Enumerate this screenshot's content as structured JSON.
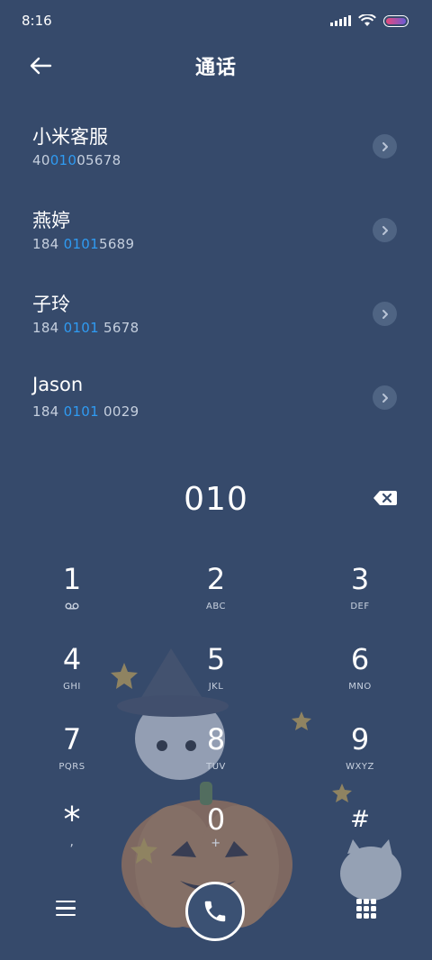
{
  "status_bar": {
    "time": "8:16",
    "icons": [
      "signal-icon",
      "wifi-icon",
      "battery-icon"
    ]
  },
  "header": {
    "title": "通话",
    "back_icon": "arrow-left-icon"
  },
  "results": [
    {
      "name": "小米客服",
      "number_pre": "40",
      "number_match": "010",
      "number_post": "05678"
    },
    {
      "name": "燕婷",
      "number_pre": "184 ",
      "number_match": "0101",
      "number_post": "5689"
    },
    {
      "name": "子玲",
      "number_pre": "184 ",
      "number_match": "0101",
      "number_post": " 5678"
    },
    {
      "name": "Jason",
      "number_pre": "184 ",
      "number_match": "0101",
      "number_post": " 0029"
    }
  ],
  "dialer": {
    "digits": "010",
    "backspace_icon": "backspace-icon"
  },
  "keypad": [
    {
      "digit": "1",
      "letters": "",
      "icon": "voicemail-icon"
    },
    {
      "digit": "2",
      "letters": "ABC"
    },
    {
      "digit": "3",
      "letters": "DEF"
    },
    {
      "digit": "4",
      "letters": "GHI"
    },
    {
      "digit": "5",
      "letters": "JKL"
    },
    {
      "digit": "6",
      "letters": "MNO"
    },
    {
      "digit": "7",
      "letters": "PQRS"
    },
    {
      "digit": "8",
      "letters": "TUV"
    },
    {
      "digit": "9",
      "letters": "WXYZ"
    },
    {
      "digit": "*",
      "letters": ","
    },
    {
      "digit": "0",
      "letters": "+"
    },
    {
      "digit": "#",
      "letters": ""
    }
  ],
  "bottom_bar": {
    "menu_icon": "menu-icon",
    "call_icon": "phone-icon",
    "keypad_icon": "keypad-grid-icon"
  },
  "colors": {
    "background": "#364a6b",
    "match_highlight": "#2f9bf2",
    "text_primary": "#ffffff",
    "text_secondary": "#c5cfde"
  }
}
